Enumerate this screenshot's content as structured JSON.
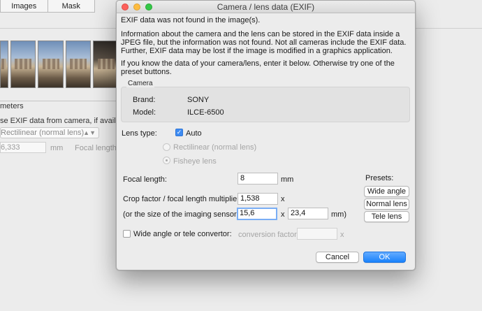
{
  "background": {
    "tabs": [
      "Images",
      "Mask"
    ],
    "section_header": "meters",
    "exif_option": "se EXIF data from camera, if available)",
    "lens_select_value": "Rectilinear (normal lens)",
    "focal_value": "6,333",
    "focal_unit": "mm",
    "focal_label": "Focal length m"
  },
  "dialog": {
    "title": "Camera / lens data (EXIF)",
    "msg_not_found": "EXIF data was not found in the image(s).",
    "msg_info": "Information about the camera and the lens can be stored in the EXIF data inside a JPEG file, but the information was not found. Not all cameras include the EXIF data. Further, EXIF data may be lost if the image is modified in a graphics application.",
    "msg_enter": "If you know the data of your camera/lens, enter it below. Otherwise try one of the preset buttons.",
    "camera": {
      "legend": "Camera",
      "brand_label": "Brand:",
      "brand_value": "SONY",
      "model_label": "Model:",
      "model_value": "ILCE-6500"
    },
    "lens_type": {
      "label": "Lens type:",
      "auto_label": "Auto",
      "auto_checked": true,
      "rectilinear_label": "Rectilinear (normal lens)",
      "fisheye_label": "Fisheye lens",
      "selected": "Fisheye lens"
    },
    "focal_length": {
      "label": "Focal length:",
      "value": "8",
      "unit": "mm"
    },
    "crop_factor": {
      "label": "Crop factor / focal length multiplier:",
      "value": "1,538",
      "suffix": "x"
    },
    "sensor": {
      "label": "(or the size of the imaging sensor:",
      "width": "15,6",
      "separator": "x",
      "height": "23,4",
      "unit": "mm)"
    },
    "convertor": {
      "label": "Wide angle or tele convertor:",
      "checked": false,
      "factor_label": "conversion factor:",
      "factor_value": "",
      "suffix": "x"
    },
    "presets": {
      "label": "Presets:",
      "buttons": [
        "Wide angle",
        "Normal lens",
        "Tele lens"
      ]
    },
    "cancel_label": "Cancel",
    "ok_label": "OK"
  }
}
